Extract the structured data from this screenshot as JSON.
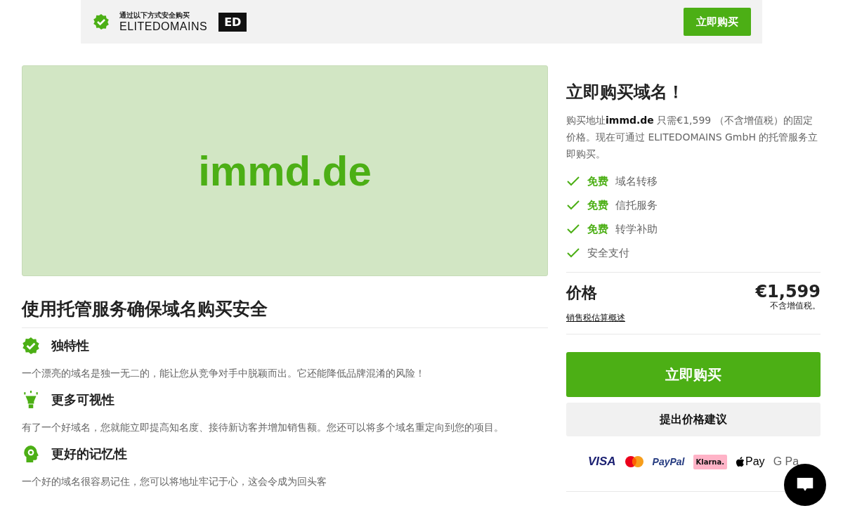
{
  "banner": {
    "caption": "通过以下方式安全购买",
    "brand": "ELITEDOMAINS",
    "brand_mark": "ED",
    "button": "立即购买"
  },
  "hero": {
    "domain": "immd.de"
  },
  "security": {
    "title": "使用托管服务确保域名购买安全",
    "features": [
      {
        "kind": "badge",
        "title": "独特性",
        "text": "一个漂亮的域名是独一无二的，能让您从竞争对手中脱颖而出。它还能降低品牌混淆的风险！"
      },
      {
        "kind": "lamp",
        "title": "更多可视性",
        "text": "有了一个好域名，您就能立即提高知名度、接待新访客并增加销售额。您还可以将多个域名重定向到您的项目。"
      },
      {
        "kind": "head",
        "title": "更好的记忆性",
        "text": "一个好的域名很容易记住，您可以将地址牢记于心，这会令成为回头客"
      }
    ]
  },
  "offer": {
    "title": "立即购买域名！",
    "intro": "购买地址**immd.de** 只需€1,599 （不含增值税）的固定价格。现在可通过 ELITEDOMAINS GmbH 的托管服务立即购买。",
    "perks": [
      {
        "free": "免费",
        "text": "域名转移"
      },
      {
        "free": "免费",
        "text": "信托服务"
      },
      {
        "free": "免费",
        "text": "转学补助"
      },
      {
        "text": "安全支付"
      }
    ],
    "price_label": "价格",
    "price": "€1,599",
    "vat_note": "不含增值税。",
    "tax_link": "销售税估算概述",
    "buy_button": "立即购买",
    "offer_button": "提出价格建议",
    "payments": [
      {
        "kind": "visa",
        "label": "VISA"
      },
      {
        "kind": "mastercard"
      },
      {
        "kind": "paypal",
        "label": "PayPal"
      },
      {
        "kind": "klarna",
        "label": "Klarna."
      },
      {
        "kind": "applepay",
        "label": "Pay"
      },
      {
        "kind": "googlepay",
        "label": "G Pa"
      }
    ]
  }
}
